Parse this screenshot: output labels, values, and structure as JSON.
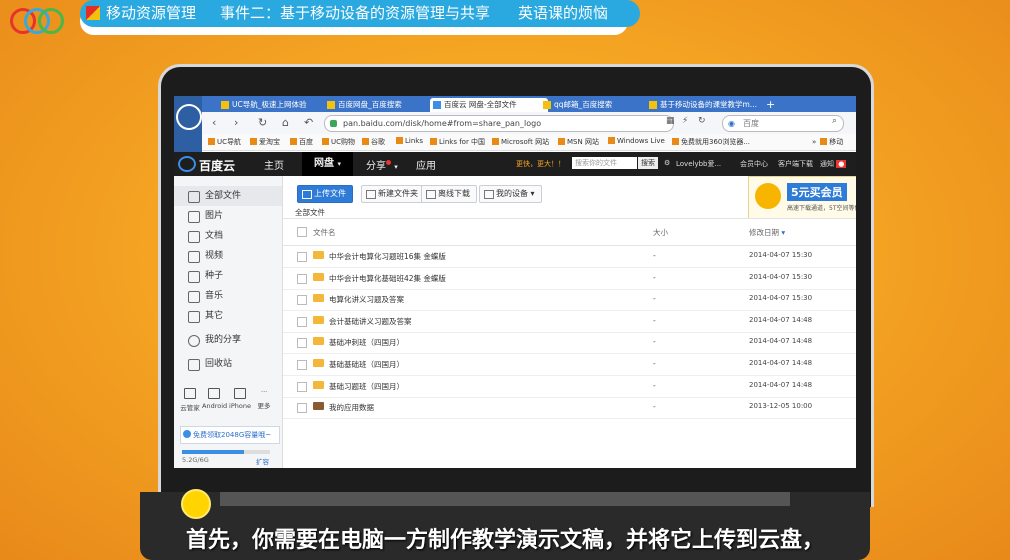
{
  "video": {
    "header_segments": [
      "移动资源管理",
      "事件二：基于移动设备的资源管理与共享",
      "英语课的烦恼"
    ],
    "subtitle": "首先，你需要在电脑一方制作教学演示文稿，并将它上传到云盘，"
  },
  "browser": {
    "tabs": [
      "UC导航_极速上网体验",
      "百度网盘_百度搜索",
      "百度云 网盘-全部文件",
      "qq邮箱_百度搜索",
      "基于移动设备的课堂教学m..."
    ],
    "url": "pan.baidu.com/disk/home#from=share_pan_logo",
    "search_placeholder": "百度",
    "bookmarks": [
      "UC导航",
      "爱淘宝",
      "百度",
      "UC购物",
      "谷歌",
      "Links",
      "Links for 中国",
      "Microsoft 网站",
      "MSN 网站",
      "Windows Live",
      "免费就用360浏览器...",
      "移动"
    ]
  },
  "app": {
    "brand": "百度云",
    "menu": [
      "主页",
      "网盘",
      "分享",
      "应用"
    ],
    "promo": "更快，更大！！",
    "search_placeholder": "搜索你的文件",
    "search_button": "搜索",
    "user": "Lovelybb爱...",
    "member_center": "会员中心",
    "client_download": "客户端下载",
    "notify": "通知"
  },
  "sidebar": {
    "items": [
      "全部文件",
      "图片",
      "文档",
      "视频",
      "种子",
      "音乐",
      "其它",
      "我的分享",
      "回收站"
    ],
    "devices": [
      "云管家",
      "Android",
      "iPhone",
      "更多"
    ],
    "free_offer": "免费领取2048G容量哦~",
    "quota": "5.2G/6G",
    "expand": "扩容"
  },
  "toolbar": {
    "upload": "上传文件",
    "new_folder": "新建文件夹",
    "offline": "离线下载",
    "my_devices": "我的设备"
  },
  "vip": {
    "title": "5元买会员",
    "sub": "高速下载通道，5T空间等你"
  },
  "crumb": "全部文件",
  "table": {
    "headers": [
      "文件名",
      "大小",
      "修改日期"
    ],
    "rows": [
      {
        "name": "中华会计电算化习题班16集 金蝶版",
        "size": "-",
        "date": "2014-04-07 15:30"
      },
      {
        "name": "中华会计电算化基础班42集 金蝶版",
        "size": "-",
        "date": "2014-04-07 15:30"
      },
      {
        "name": "电算化讲义习题及答案",
        "size": "-",
        "date": "2014-04-07 15:30"
      },
      {
        "name": "会计基础讲义习题及答案",
        "size": "-",
        "date": "2014-04-07 14:48"
      },
      {
        "name": "基础冲刺班（四国月）",
        "size": "-",
        "date": "2014-04-07 14:48"
      },
      {
        "name": "基础基础班（四国月）",
        "size": "-",
        "date": "2014-04-07 14:48"
      },
      {
        "name": "基础习题班（四国月）",
        "size": "-",
        "date": "2014-04-07 14:48"
      },
      {
        "name": "我的应用数据",
        "size": "-",
        "date": "2013-12-05 10:00"
      }
    ]
  }
}
